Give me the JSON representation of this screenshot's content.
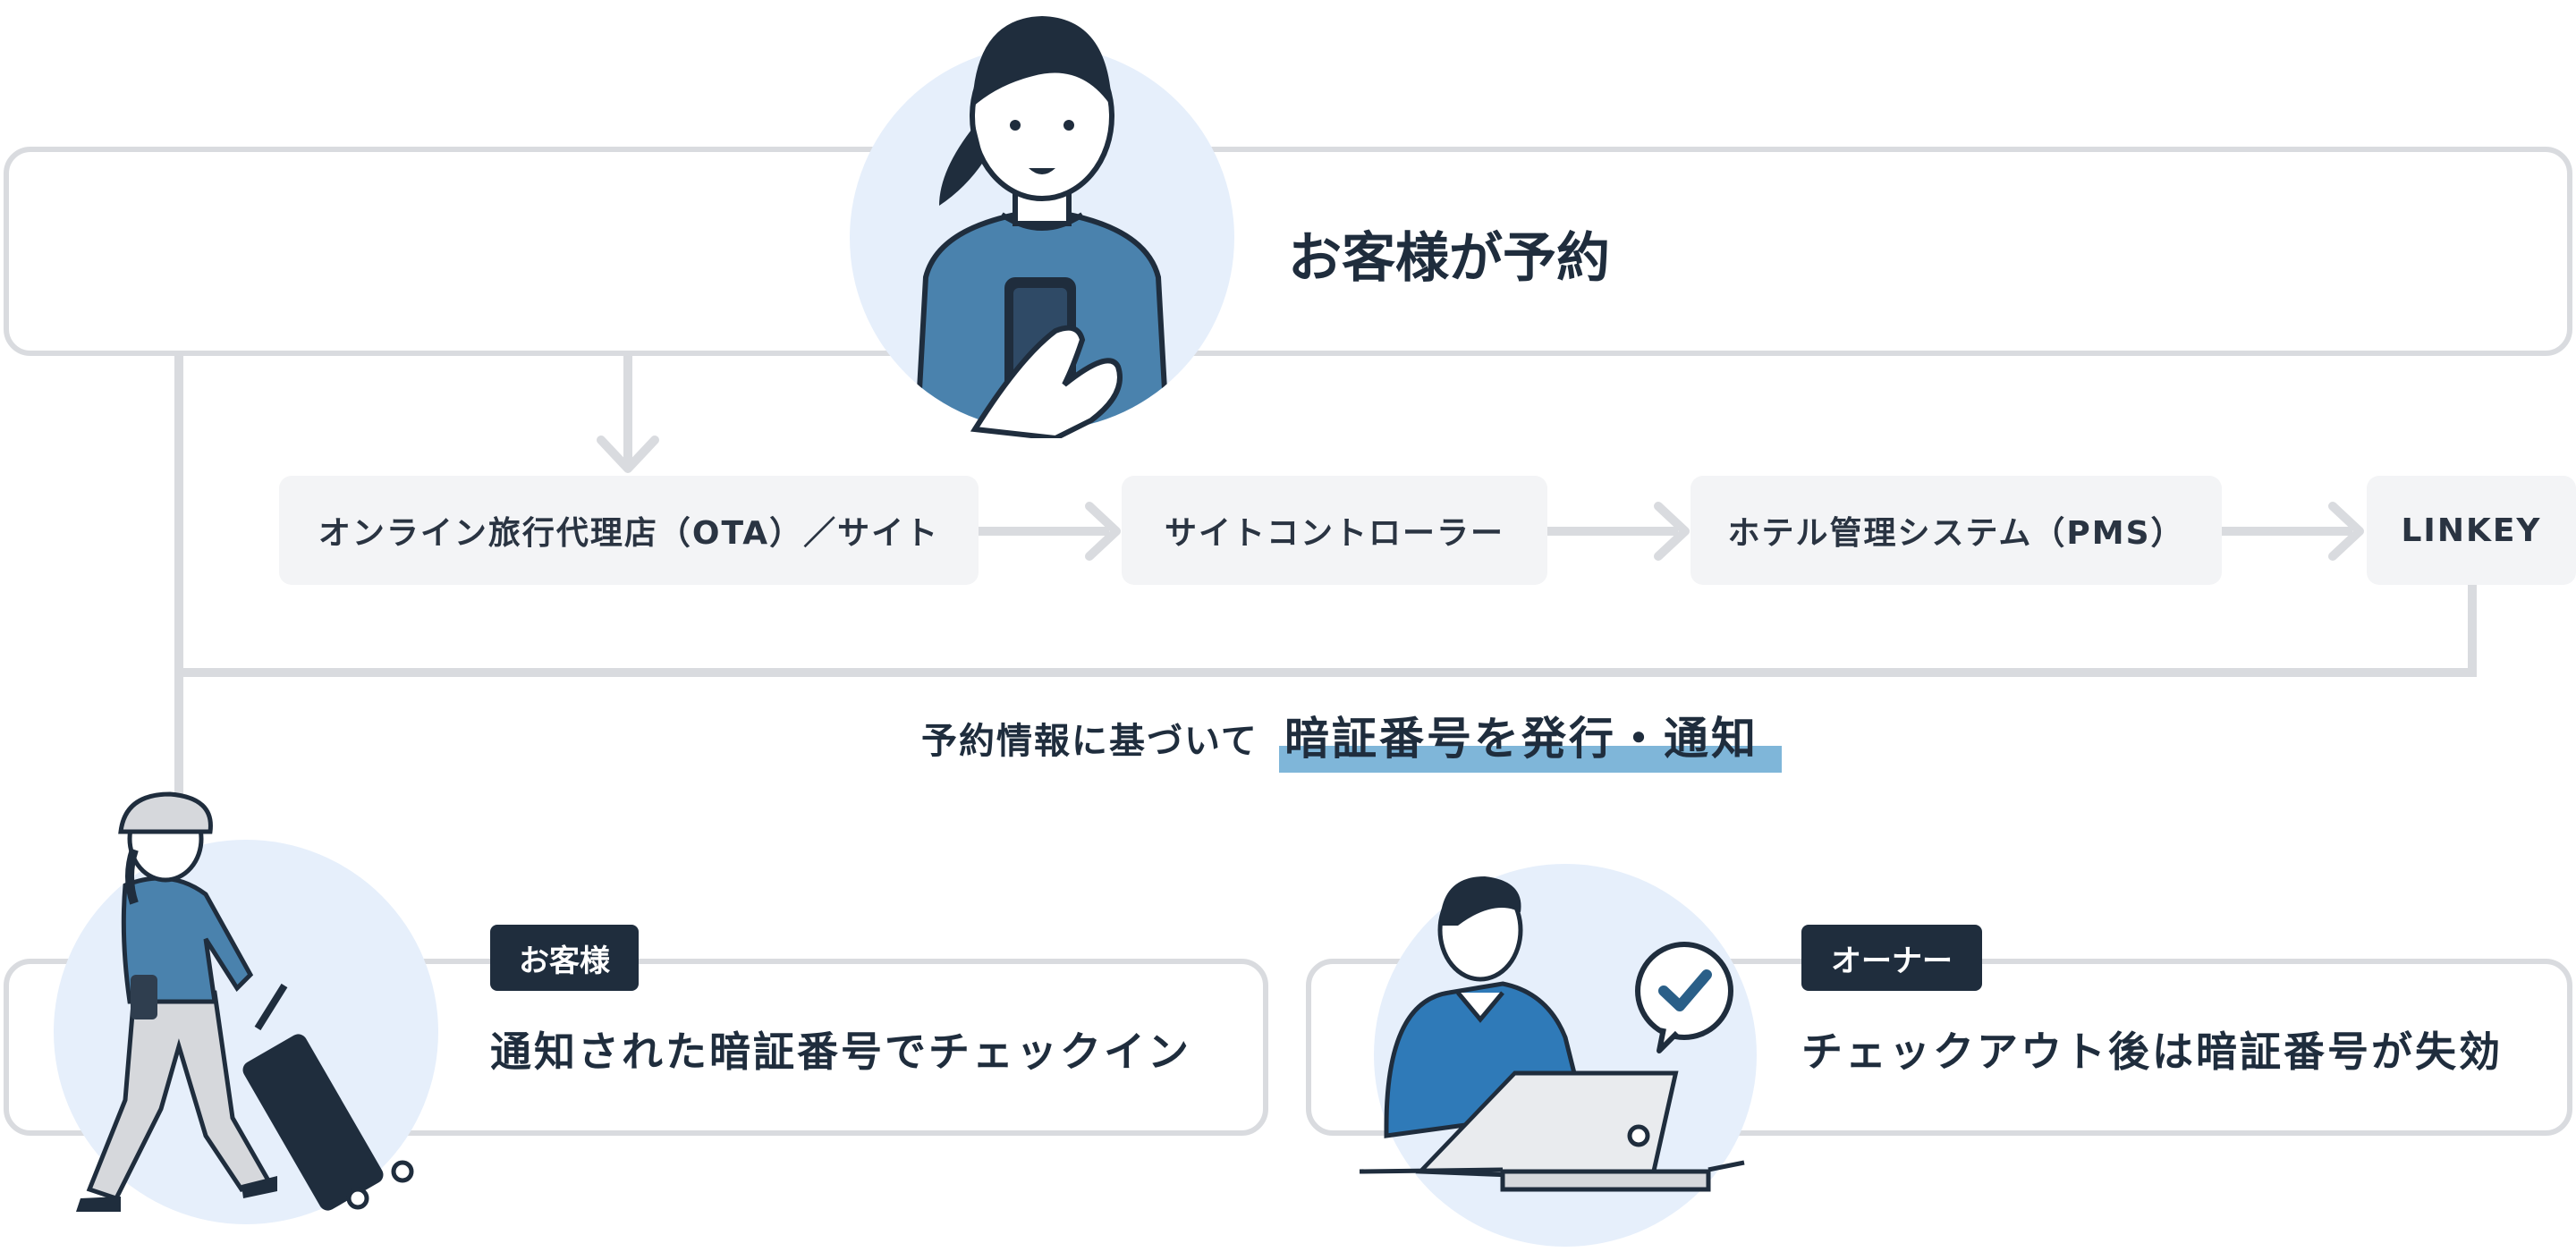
{
  "header": {
    "title": "お客様が予約"
  },
  "flow": {
    "nodes": [
      {
        "label": "オンライン旅行代理店（OTA）／サイト"
      },
      {
        "label": "サイトコントローラー"
      },
      {
        "label": "ホテル管理システム（PMS）"
      },
      {
        "label": "LINKEY"
      }
    ]
  },
  "notice": {
    "prefix": "予約情報に基づいて",
    "highlight": "暗証番号を発行・通知",
    "highlight_color": "#7fb6d9"
  },
  "guest": {
    "badge": "お客様",
    "text": "通知された暗証番号でチェックイン"
  },
  "owner": {
    "badge": "オーナー",
    "text": "チェックアウト後は暗証番号が失効"
  },
  "colors": {
    "line": "#d9dbdf",
    "navy": "#1f2d3d",
    "circle_bg": "#e6effb",
    "shirt": "#4a82ad"
  }
}
